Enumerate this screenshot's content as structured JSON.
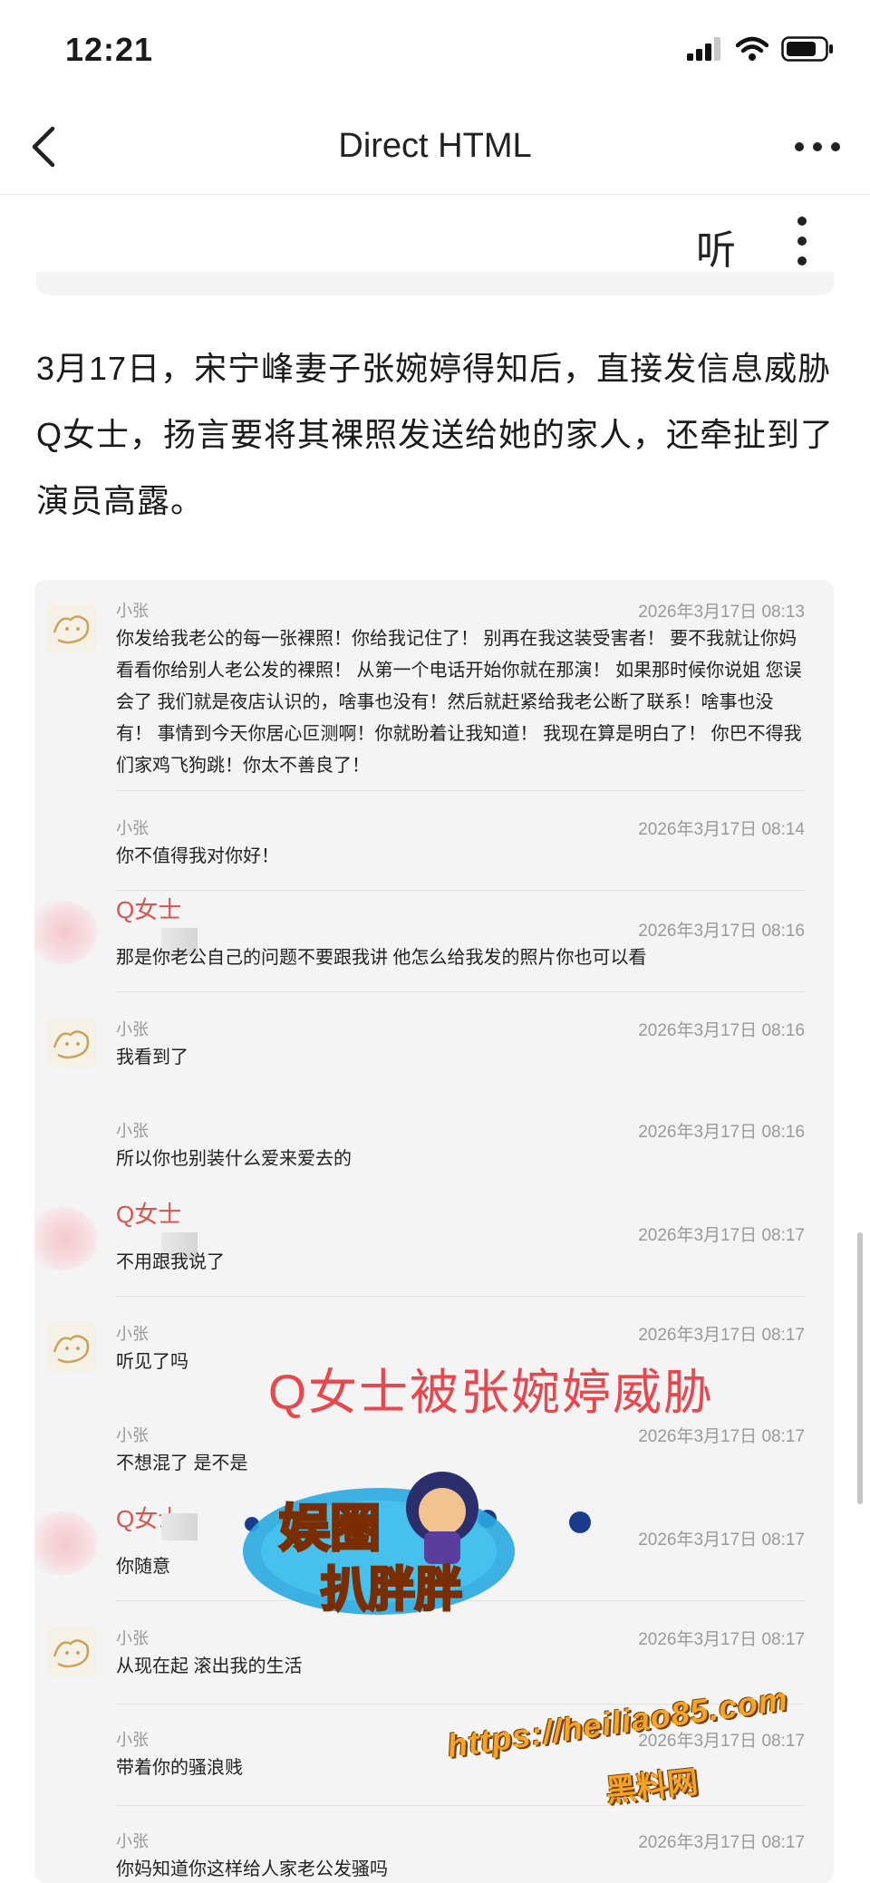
{
  "status_bar": {
    "time": "12:21"
  },
  "nav": {
    "title": "Direct HTML"
  },
  "toolbar": {
    "listen_label": "听"
  },
  "article": {
    "paragraph": "3月17日，宋宁峰妻子张婉婷得知后，直接发信息威胁Q女士，扬言要将其裸照发送给她的家人，还牵扯到了演员高露。"
  },
  "chat": {
    "messages": [
      {
        "sender": "小张",
        "time": "2026年3月17日 08:13",
        "text": "你发给我老公的每一张裸照！你给我记住了！ 别再在我这装受害者！ 要不我就让你妈看看你给别人老公发的裸照！ 从第一个电话开始你就在那演！ 如果那时候你说姐 您误会了 我们就是夜店认识的，啥事也没有！然后就赶紧给我老公断了联系！啥事也没有！ 事情到今天你居心叵测啊！你就盼着让我知道！ 我现在算是明白了！ 你巴不得我们家鸡飞狗跳！你太不善良了！"
      },
      {
        "sender": "小张",
        "time": "2026年3月17日 08:14",
        "text": "你不值得我对你好！"
      },
      {
        "sender": "Q女士",
        "time": "2026年3月17日 08:16",
        "text": "那是你老公自己的问题不要跟我讲 他怎么给我发的照片你也可以看"
      },
      {
        "sender": "小张",
        "time": "2026年3月17日 08:16",
        "text": "我看到了"
      },
      {
        "sender": "小张",
        "time": "2026年3月17日 08:16",
        "text": "所以你也别装什么爱来爱去的"
      },
      {
        "sender": "Q女士",
        "time": "2026年3月17日 08:17",
        "text": "不用跟我说了"
      },
      {
        "sender": "小张",
        "time": "2026年3月17日 08:17",
        "text": "听见了吗"
      },
      {
        "sender": "小张",
        "time": "2026年3月17日 08:17",
        "text": "不想混了 是不是"
      },
      {
        "sender": "Q女士",
        "time": "2026年3月17日 08:17",
        "text": "你随意"
      },
      {
        "sender": "小张",
        "time": "2026年3月17日 08:17",
        "text": "从现在起 滚出我的生活"
      },
      {
        "sender": "小张",
        "time": "2026年3月17日 08:17",
        "text": "带着你的骚浪贱"
      },
      {
        "sender": "小张",
        "time": "2026年3月17日 08:17",
        "text": "你妈知道你这样给人家老公发骚吗"
      }
    ]
  },
  "overlay": {
    "caption": "Q女士被张婉婷威胁",
    "logo_text_top": "娱圈",
    "logo_text_bottom": "扒胖胖",
    "watermark_url": "https://heiliao85.com",
    "watermark_site": "黑料网"
  },
  "colors": {
    "accent_red": "#e8474d",
    "watermark_orange": "#f5a524",
    "card_bg": "#f4f4f5"
  }
}
